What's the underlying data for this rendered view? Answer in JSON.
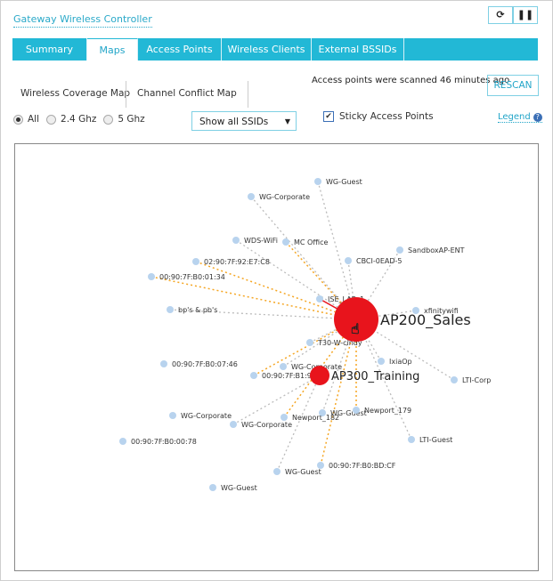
{
  "header": {
    "title": "Gateway Wireless Controller",
    "refresh_icon": "refresh-icon",
    "pause_icon": "pause-icon"
  },
  "tabs": [
    {
      "label": "Summary"
    },
    {
      "label": "Maps",
      "active": true
    },
    {
      "label": "Access Points"
    },
    {
      "label": "Wireless Clients"
    },
    {
      "label": "External BSSIDs"
    }
  ],
  "subtabs": {
    "coverage": "Wireless Coverage Map",
    "conflict": "Channel Conflict Map"
  },
  "scan_status": "Access points were scanned 46 minutes ago",
  "rescan_label": "RESCAN",
  "band_filter": {
    "options": [
      "All",
      "2.4 Ghz",
      "5 Ghz"
    ],
    "selected": "All"
  },
  "ssid_select": {
    "value": "Show all SSIDs"
  },
  "sticky": {
    "label": "Sticky Access Points",
    "checked": true
  },
  "legend_label": "Legend",
  "map": {
    "access_points": [
      {
        "name": "AP200_Sales"
      },
      {
        "name": "AP300_Training"
      }
    ],
    "neighbors": [
      {
        "label": "WG-Guest",
        "ap": 0,
        "type": "normal"
      },
      {
        "label": "WG-Corporate",
        "ap": 0,
        "type": "normal"
      },
      {
        "label": "WDS-WiFi",
        "ap": 0,
        "type": "normal"
      },
      {
        "label": "MC Office",
        "ap": 0,
        "type": "conflict"
      },
      {
        "label": "SandboxAP-ENT",
        "ap": 0,
        "type": "normal"
      },
      {
        "label": "CBCI-0EAD-5",
        "ap": 0,
        "type": "normal"
      },
      {
        "label": "02:90:7F:92:E7:C8",
        "ap": 0,
        "type": "conflict"
      },
      {
        "label": "00:90:7F:B0:01:34",
        "ap": 0,
        "type": "conflict"
      },
      {
        "label": "ISE_LAB_1",
        "ap": 0,
        "type": "selected"
      },
      {
        "label": "bp's & pb's",
        "ap": 0,
        "type": "normal"
      },
      {
        "label": "xfinitywifi",
        "ap": 0,
        "type": "normal"
      },
      {
        "label": "T30-W-cindy",
        "ap": 0,
        "type": "normal"
      },
      {
        "label": "IxiaOp",
        "ap": 0,
        "type": "normal"
      },
      {
        "label": "00:90:7F:B0:07:46",
        "ap": null,
        "type": "none"
      },
      {
        "label": "WG-Corporate",
        "ap": 0,
        "type": "normal"
      },
      {
        "label": "00:90:7F:B1:93:F0",
        "ap": 0,
        "type": "conflict"
      },
      {
        "label": "LTI-Corp",
        "ap": 0,
        "type": "normal"
      },
      {
        "label": "WG-Corporate",
        "ap": null,
        "type": "none"
      },
      {
        "label": "WG-Corporate",
        "ap": 1,
        "type": "normal"
      },
      {
        "label": "Newport_182",
        "ap": 0,
        "type": "conflict"
      },
      {
        "label": "WG-Guest",
        "ap": 0,
        "type": "normal"
      },
      {
        "label": "Newport_179",
        "ap": 0,
        "type": "conflict"
      },
      {
        "label": "LTI-Guest",
        "ap": 0,
        "type": "normal"
      },
      {
        "label": "00:90:7F:B0:00:78",
        "ap": null,
        "type": "none"
      },
      {
        "label": "00:90:7F:B0:BD:CF",
        "ap": 0,
        "type": "conflict"
      },
      {
        "label": "WG-Guest",
        "ap": 1,
        "type": "normal"
      },
      {
        "label": "WG-Guest",
        "ap": null,
        "type": "none"
      }
    ],
    "colors": {
      "ap": "#e8141c",
      "node": "#b8d3ee",
      "conflict": "#f5a623",
      "normal": "#bbbbbb",
      "selected": "#e8141c"
    }
  }
}
